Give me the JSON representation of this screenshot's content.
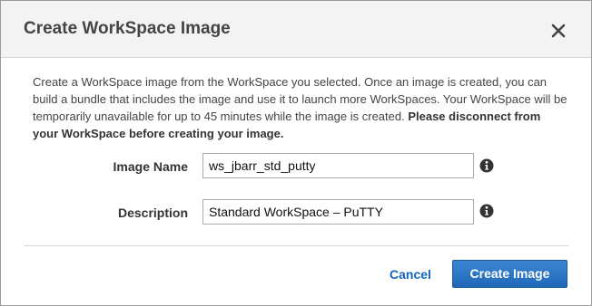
{
  "dialog": {
    "title": "Create WorkSpace Image",
    "close_icon": "close-icon",
    "intro_text": "Create a WorkSpace image from the WorkSpace you selected. Once an image is created, you can build a bundle that includes the image and use it to launch more WorkSpaces. Your WorkSpace will be temporarily unavailable for up to 45 minutes while the image is created. ",
    "intro_bold": "Please disconnect from your WorkSpace before creating your image."
  },
  "form": {
    "image_name_label": "Image Name",
    "image_name_value": "ws_jbarr_std_putty",
    "description_label": "Description",
    "description_value": "Standard WorkSpace – PuTTY",
    "info_icon": "info-icon"
  },
  "footer": {
    "cancel_label": "Cancel",
    "create_label": "Create Image"
  },
  "colors": {
    "primary_button": "#2a73c4",
    "link": "#1166bb"
  }
}
